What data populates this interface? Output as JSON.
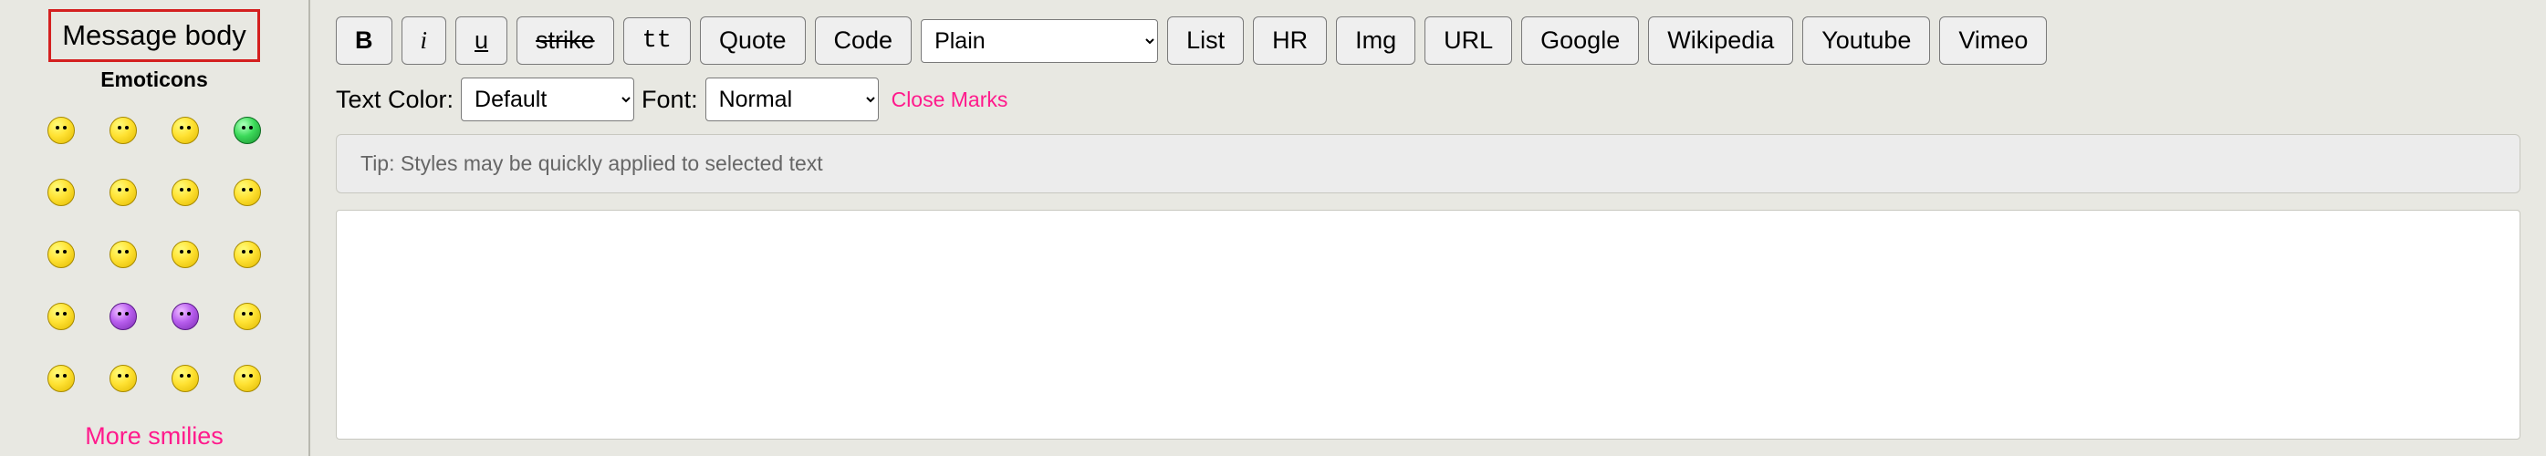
{
  "sidebar": {
    "title": "Message body",
    "emoticons_label": "Emoticons",
    "more_smilies": "More smilies"
  },
  "toolbar": {
    "bold": "B",
    "italic": "i",
    "underline": "u",
    "strike": "strike",
    "tt": "tt",
    "quote": "Quote",
    "code": "Code",
    "plain_selected": "Plain",
    "list": "List",
    "hr": "HR",
    "img": "Img",
    "url": "URL",
    "google": "Google",
    "wikipedia": "Wikipedia",
    "youtube": "Youtube",
    "vimeo": "Vimeo"
  },
  "row2": {
    "text_color_label": "Text Color:",
    "text_color_selected": "Default",
    "font_label": "Font:",
    "font_selected": "Normal",
    "close_marks": "Close Marks"
  },
  "tip": "Tip: Styles may be quickly applied to selected text",
  "editor_value": ""
}
